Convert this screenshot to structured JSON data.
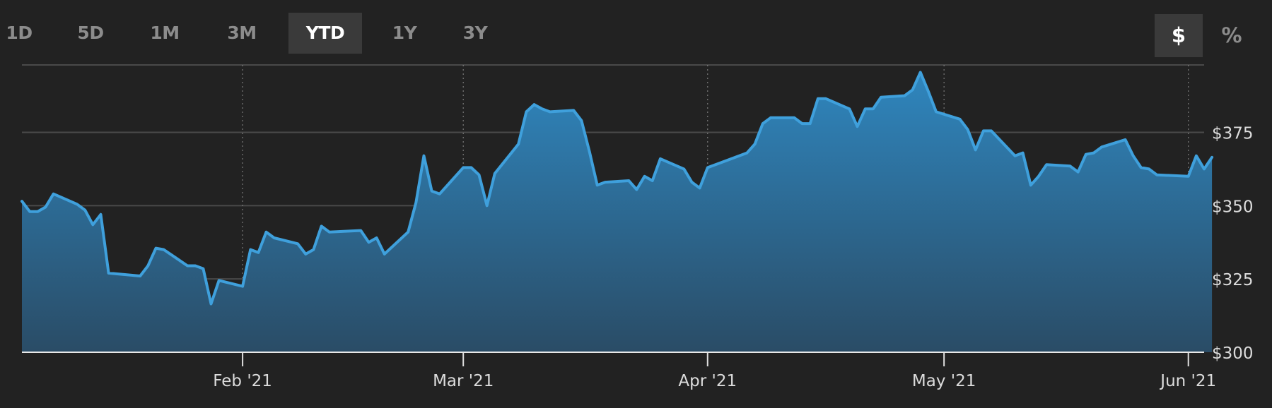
{
  "range_tabs": [
    {
      "label": "1D",
      "active": false
    },
    {
      "label": "5D",
      "active": false
    },
    {
      "label": "1M",
      "active": false
    },
    {
      "label": "3M",
      "active": false
    },
    {
      "label": "YTD",
      "active": true
    },
    {
      "label": "1Y",
      "active": false
    },
    {
      "label": "3Y",
      "active": false
    }
  ],
  "unit_tabs": [
    {
      "label": "$",
      "active": true
    },
    {
      "label": "%",
      "active": false
    }
  ],
  "colors": {
    "background": "#222222",
    "line": "#3fa0dc",
    "fill_top": "#2f86be",
    "fill_bottom": "#2a4c66",
    "grid": "#4a4a4a",
    "axis_text": "#dcdcdc"
  },
  "chart_data": {
    "type": "area",
    "x_start": "2021-01-04",
    "x_end": "2021-06-03",
    "ylim": [
      300,
      398
    ],
    "y_ticks": [
      {
        "value": 300,
        "label": "$300"
      },
      {
        "value": 325,
        "label": "$325"
      },
      {
        "value": 350,
        "label": "$350"
      },
      {
        "value": 375,
        "label": "$375"
      }
    ],
    "x_ticks": [
      {
        "date": "2021-02-01",
        "label": "Feb '21"
      },
      {
        "date": "2021-03-01",
        "label": "Mar '21"
      },
      {
        "date": "2021-04-01",
        "label": "Apr '21"
      },
      {
        "date": "2021-05-01",
        "label": "May '21"
      },
      {
        "date": "2021-06-01",
        "label": "Jun '21"
      }
    ],
    "series": [
      {
        "points": [
          [
            "2021-01-04",
            351.5
          ],
          [
            "2021-01-05",
            348
          ],
          [
            "2021-01-06",
            348
          ],
          [
            "2021-01-07",
            349.5
          ],
          [
            "2021-01-08",
            354
          ],
          [
            "2021-01-11",
            350.5
          ],
          [
            "2021-01-12",
            348.5
          ],
          [
            "2021-01-13",
            343.5
          ],
          [
            "2021-01-14",
            347
          ],
          [
            "2021-01-15",
            327
          ],
          [
            "2021-01-19",
            326
          ],
          [
            "2021-01-20",
            329.5
          ],
          [
            "2021-01-21",
            335.5
          ],
          [
            "2021-01-22",
            335
          ],
          [
            "2021-01-25",
            329.5
          ],
          [
            "2021-01-26",
            329.5
          ],
          [
            "2021-01-27",
            328.5
          ],
          [
            "2021-01-28",
            316.5
          ],
          [
            "2021-01-29",
            324.5
          ],
          [
            "2021-02-01",
            322.5
          ],
          [
            "2021-02-02",
            335
          ],
          [
            "2021-02-03",
            334
          ],
          [
            "2021-02-04",
            341
          ],
          [
            "2021-02-05",
            339
          ],
          [
            "2021-02-08",
            337
          ],
          [
            "2021-02-09",
            333.5
          ],
          [
            "2021-02-10",
            335
          ],
          [
            "2021-02-11",
            343
          ],
          [
            "2021-02-12",
            341
          ],
          [
            "2021-02-16",
            341.5
          ],
          [
            "2021-02-17",
            337.5
          ],
          [
            "2021-02-18",
            339
          ],
          [
            "2021-02-19",
            333.5
          ],
          [
            "2021-02-22",
            341
          ],
          [
            "2021-02-23",
            351
          ],
          [
            "2021-02-24",
            367
          ],
          [
            "2021-02-25",
            355
          ],
          [
            "2021-02-26",
            354
          ],
          [
            "2021-03-01",
            363
          ],
          [
            "2021-03-02",
            363
          ],
          [
            "2021-03-03",
            360.5
          ],
          [
            "2021-03-04",
            350
          ],
          [
            "2021-03-05",
            361
          ],
          [
            "2021-03-08",
            371
          ],
          [
            "2021-03-09",
            382
          ],
          [
            "2021-03-10",
            384.5
          ],
          [
            "2021-03-11",
            383
          ],
          [
            "2021-03-12",
            382
          ],
          [
            "2021-03-15",
            382.5
          ],
          [
            "2021-03-16",
            379
          ],
          [
            "2021-03-17",
            368.5
          ],
          [
            "2021-03-18",
            357
          ],
          [
            "2021-03-19",
            358
          ],
          [
            "2021-03-22",
            358.5
          ],
          [
            "2021-03-23",
            355.5
          ],
          [
            "2021-03-24",
            360
          ],
          [
            "2021-03-25",
            358.5
          ],
          [
            "2021-03-26",
            366
          ],
          [
            "2021-03-29",
            362.5
          ],
          [
            "2021-03-30",
            358
          ],
          [
            "2021-03-31",
            356
          ],
          [
            "2021-04-01",
            363
          ],
          [
            "2021-04-06",
            368
          ],
          [
            "2021-04-07",
            371
          ],
          [
            "2021-04-08",
            378
          ],
          [
            "2021-04-09",
            380
          ],
          [
            "2021-04-12",
            380
          ],
          [
            "2021-04-13",
            378
          ],
          [
            "2021-04-14",
            378
          ],
          [
            "2021-04-15",
            386.5
          ],
          [
            "2021-04-16",
            386.5
          ],
          [
            "2021-04-19",
            383
          ],
          [
            "2021-04-20",
            377
          ],
          [
            "2021-04-21",
            383
          ],
          [
            "2021-04-22",
            383
          ],
          [
            "2021-04-23",
            387
          ],
          [
            "2021-04-26",
            387.5
          ],
          [
            "2021-04-27",
            389.5
          ],
          [
            "2021-04-28",
            395.5
          ],
          [
            "2021-04-29",
            389
          ],
          [
            "2021-04-30",
            382
          ],
          [
            "2021-05-03",
            379.5
          ],
          [
            "2021-05-04",
            376
          ],
          [
            "2021-05-05",
            369
          ],
          [
            "2021-05-06",
            375.5
          ],
          [
            "2021-05-07",
            375.5
          ],
          [
            "2021-05-10",
            367
          ],
          [
            "2021-05-11",
            368
          ],
          [
            "2021-05-12",
            357
          ],
          [
            "2021-05-13",
            360
          ],
          [
            "2021-05-14",
            364
          ],
          [
            "2021-05-17",
            363.5
          ],
          [
            "2021-05-18",
            361.5
          ],
          [
            "2021-05-19",
            367.5
          ],
          [
            "2021-05-20",
            368
          ],
          [
            "2021-05-21",
            370
          ],
          [
            "2021-05-24",
            372.5
          ],
          [
            "2021-05-25",
            367
          ],
          [
            "2021-05-26",
            363
          ],
          [
            "2021-05-27",
            362.5
          ],
          [
            "2021-05-28",
            360.5
          ],
          [
            "2021-06-01",
            360
          ],
          [
            "2021-06-02",
            367
          ],
          [
            "2021-06-03",
            362.5
          ],
          [
            "2021-06-04",
            366.5
          ]
        ]
      }
    ],
    "grid": true
  }
}
